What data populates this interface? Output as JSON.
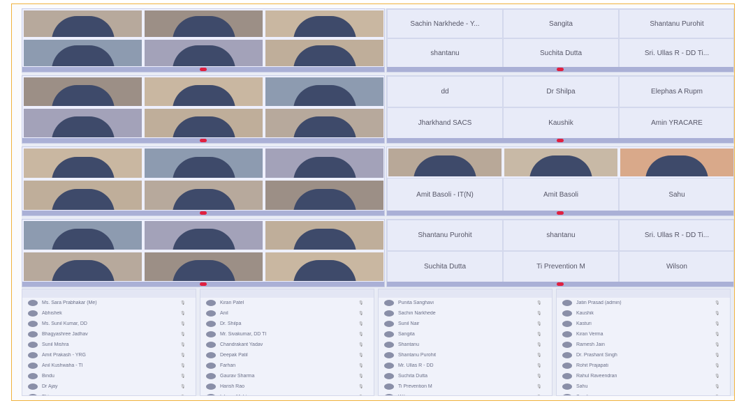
{
  "name_panels": [
    [
      "Sachin Narkhede - Y...",
      "Sangita",
      "Shantanu Purohit",
      "shantanu",
      "Suchita Dutta",
      "Sri. Ullas R - DD Ti..."
    ],
    [
      "dd",
      "Dr Shilpa",
      "Elephas A Rupm",
      "Jharkhand SACS",
      "Kaushik",
      "Amin YRACARE"
    ],
    [
      "Amit Basoli - IT(N)",
      "Amit Basoli",
      "Sahu"
    ],
    [
      "Shantanu Purohit",
      "shantanu",
      "Sri. Ullas R - DD Ti...",
      "Suchita Dutta",
      "Ti Prevention M",
      "Wilson"
    ]
  ],
  "participant_lists": [
    [
      "Ms. Sara Prabhakar (Me)",
      "Abhishek",
      "Ms. Sunil Kumar, DD",
      "Bhagyashree Jadhav",
      "Sunil Mishra",
      "Amit Prakash - YRG",
      "Anil Kushwaha - TI",
      "Bindu",
      "Dr Ajay",
      "Ekta"
    ],
    [
      "Kiran Patel",
      "Anil",
      "Dr. Shilpa",
      "Mr. Sivakumar, DD TI",
      "Chandrakant Yadav",
      "Deepak Patil",
      "Farhan",
      "Gaurav Sharma",
      "Harish Rao",
      "Ishaan Mehta"
    ],
    [
      "Punita Sanghavi",
      "Sachin Narkhede",
      "Sunil Nair",
      "Sangita",
      "Shantanu",
      "Shantanu Purohit",
      "Mr. Ullas R - DD",
      "Suchita Dutta",
      "Ti Prevention M",
      "Wilson"
    ],
    [
      "Jatin Prasad (admin)",
      "Kaushik",
      "Kasturi",
      "Kiran Verma",
      "Ramesh Jain",
      "Dr. Prashant Singh",
      "Rohit Prajapati",
      "Rahul Raveendran",
      "Sahu",
      "Sandip"
    ]
  ]
}
